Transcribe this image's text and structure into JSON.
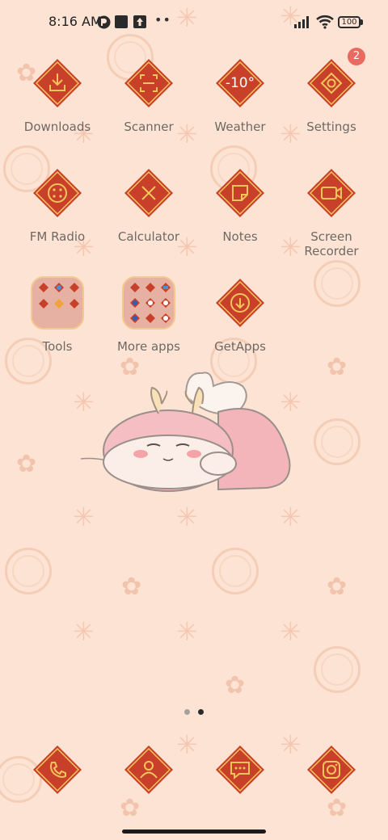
{
  "status_bar": {
    "time": "8:16 AM",
    "battery": "100",
    "icons": [
      "status-icon-app",
      "status-icon-square",
      "status-icon-upload",
      "more-dots",
      "signal-icon",
      "wifi-icon",
      "battery-icon"
    ]
  },
  "apps": [
    {
      "label": "Downloads",
      "icon": "download-icon"
    },
    {
      "label": "Scanner",
      "icon": "scan-icon"
    },
    {
      "label": "Weather",
      "icon": "weather-icon",
      "value": "-10°"
    },
    {
      "label": "Settings",
      "icon": "gear-icon",
      "badge": "2"
    },
    {
      "label": "FM Radio",
      "icon": "radio-icon"
    },
    {
      "label": "Calculator",
      "icon": "calculator-icon"
    },
    {
      "label": "Notes",
      "icon": "note-icon"
    },
    {
      "label": "Screen\nRecorder",
      "icon": "video-camera-icon"
    },
    {
      "label": "Tools",
      "icon": "folder-icon"
    },
    {
      "label": "More apps",
      "icon": "folder-icon"
    },
    {
      "label": "GetApps",
      "icon": "get-apps-icon"
    }
  ],
  "page_indicator": {
    "pages": 2,
    "current": 2
  },
  "dock": [
    {
      "icon": "phone-icon"
    },
    {
      "icon": "contacts-icon"
    },
    {
      "icon": "messages-icon"
    },
    {
      "icon": "camera-icon"
    }
  ],
  "colors": {
    "background": "#fde3d3",
    "icon_red": "#c8402a",
    "icon_gold": "#f2c55c",
    "label": "#6f6761",
    "badge": "#e86a60"
  }
}
